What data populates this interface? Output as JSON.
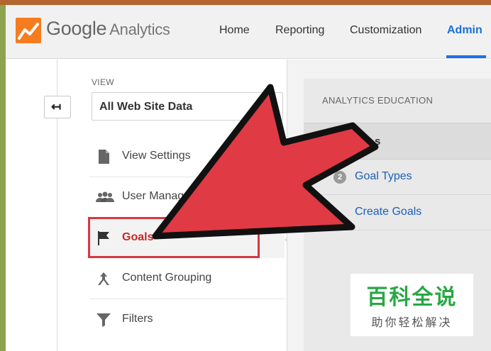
{
  "header": {
    "brand_google": "Google",
    "brand_product": "Analytics",
    "nav": {
      "home": "Home",
      "reporting": "Reporting",
      "customization": "Customization",
      "admin": "Admin"
    },
    "active_tab": "Admin"
  },
  "view_panel": {
    "label": "VIEW",
    "selected_view": "All Web Site Data",
    "back_icon": "arrow-left-icon"
  },
  "menu": [
    {
      "label": "View Settings",
      "icon": "document-icon"
    },
    {
      "label": "User Manag",
      "icon": "users-icon"
    },
    {
      "label": "Goals",
      "icon": "flag-icon",
      "selected": true
    },
    {
      "label": "Content Grouping",
      "icon": "content-grouping-icon"
    },
    {
      "label": "Filters",
      "icon": "filter-icon"
    }
  ],
  "education": {
    "title": "ANALYTICS EDUCATION",
    "rows": [
      {
        "text": "s"
      },
      {
        "number": "2",
        "text": "Goal Types"
      },
      {
        "text": "Create Goals"
      }
    ]
  },
  "colors": {
    "accent_blue": "#1a73e8",
    "highlight_red": "#d6383f",
    "arrow_red": "#e03a45",
    "logo_orange": "#f57c1f",
    "watermark_green": "#28a745"
  },
  "watermark": {
    "title": "百科全说",
    "subtitle": "助你轻松解决"
  }
}
